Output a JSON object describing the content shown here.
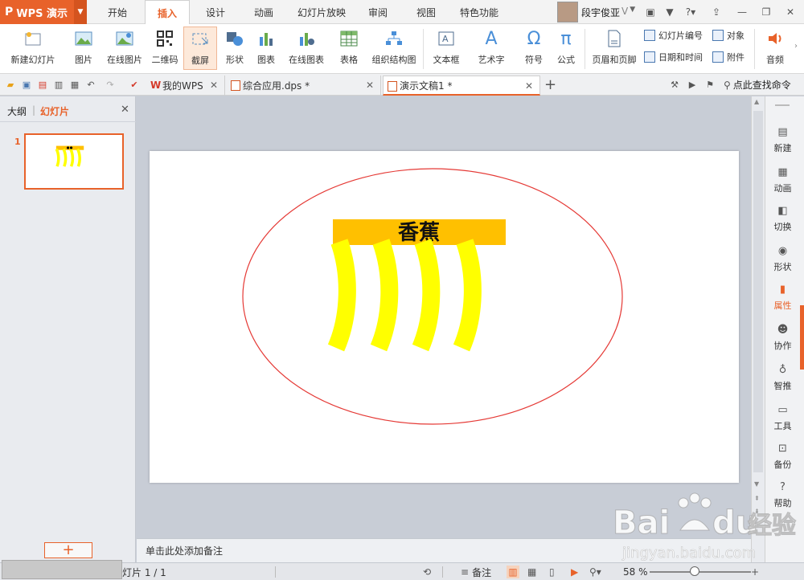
{
  "titlebar": {
    "app_name": "WPS 演示",
    "menu_tabs": [
      "开始",
      "插入",
      "设计",
      "动画",
      "幻灯片放映",
      "审阅",
      "视图",
      "特色功能"
    ],
    "active_tab": "插入",
    "user_name": "段宇俊亚",
    "user_badge": "V"
  },
  "ribbon": {
    "buttons": [
      {
        "label": "新建幻灯片",
        "icon": "new-slide-icon"
      },
      {
        "label": "图片",
        "icon": "picture-icon"
      },
      {
        "label": "在线图片",
        "icon": "online-picture-icon"
      },
      {
        "label": "二维码",
        "icon": "qrcode-icon"
      },
      {
        "label": "截屏",
        "icon": "screenshot-icon"
      },
      {
        "label": "形状",
        "icon": "shapes-icon"
      },
      {
        "label": "图表",
        "icon": "chart-icon"
      },
      {
        "label": "在线图表",
        "icon": "online-chart-icon"
      },
      {
        "label": "表格",
        "icon": "table-icon"
      },
      {
        "label": "组织结构图",
        "icon": "org-chart-icon"
      },
      {
        "label": "文本框",
        "icon": "textbox-icon"
      },
      {
        "label": "艺术字",
        "icon": "wordart-icon"
      },
      {
        "label": "符号",
        "icon": "symbol-icon"
      },
      {
        "label": "公式",
        "icon": "formula-icon"
      },
      {
        "label": "页眉和页脚",
        "icon": "header-footer-icon"
      },
      {
        "label": "音频",
        "icon": "audio-icon"
      }
    ],
    "small_buttons": [
      "幻灯片编号",
      "对象",
      "日期和时间",
      "附件"
    ]
  },
  "doctabs": {
    "tabs": [
      {
        "label": "我的WPS"
      },
      {
        "label": "综合应用.dps *"
      },
      {
        "label": "演示文稿1 *"
      }
    ],
    "search_label": "点此查找命令"
  },
  "leftpanel": {
    "tab_outline": "大纲",
    "tab_slides": "幻灯片",
    "slide_number": "1"
  },
  "slide": {
    "title_text": "香蕉",
    "title_bg": "#ffc000",
    "banana_color": "#ffff00",
    "ellipse_color": "#e53935"
  },
  "notes_placeholder": "单击此处添加备注",
  "sidepane": {
    "items": [
      {
        "label": "新建",
        "icon": "new-icon"
      },
      {
        "label": "动画",
        "icon": "animation-icon"
      },
      {
        "label": "切换",
        "icon": "transition-icon"
      },
      {
        "label": "形状",
        "icon": "shape-icon"
      },
      {
        "label": "属性",
        "icon": "property-icon"
      },
      {
        "label": "协作",
        "icon": "collab-icon"
      },
      {
        "label": "智推",
        "icon": "recommend-icon"
      },
      {
        "label": "工具",
        "icon": "tools-icon"
      },
      {
        "label": "备份",
        "icon": "backup-icon"
      },
      {
        "label": "帮助",
        "icon": "help-icon"
      }
    ]
  },
  "statusbar": {
    "slide_info": "灯片 1 / 1",
    "notes_label": "备注",
    "zoom": "58 %"
  },
  "watermark": {
    "brand": "Bai",
    "brand2": "du",
    "chinese": "经验",
    "url": "jingyan.baidu.com"
  }
}
